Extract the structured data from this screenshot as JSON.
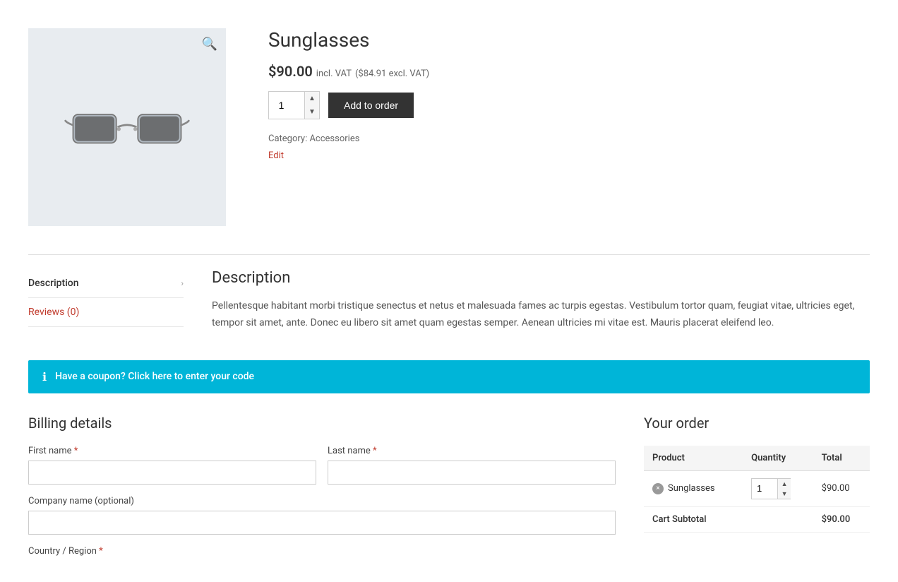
{
  "product": {
    "title": "Sunglasses",
    "price": "$90.00",
    "price_incl": "incl. VAT",
    "price_excl": "($84.91 excl. VAT)",
    "quantity": "1",
    "add_to_order_label": "Add to order",
    "category_label": "Category:",
    "category": "Accessories",
    "edit_label": "Edit"
  },
  "tabs": [
    {
      "label": "Description",
      "active": true,
      "id": "description"
    },
    {
      "label": "Reviews (0)",
      "active": false,
      "id": "reviews",
      "color": "red"
    }
  ],
  "description": {
    "title": "Description",
    "text": "Pellentesque habitant morbi tristique senectus et netus et malesuada fames ac turpis egestas. Vestibulum tortor quam, feugiat vitae, ultricies eget, tempor sit amet, ante. Donec eu libero sit amet quam egestas semper. Aenean ultricies mi vitae est. Mauris placerat eleifend leo."
  },
  "coupon": {
    "text": "Have a coupon? Click here to enter your code"
  },
  "billing": {
    "title": "Billing details",
    "first_name_label": "First name",
    "last_name_label": "Last name",
    "company_name_label": "Company name (optional)",
    "country_label": "Country / Region"
  },
  "order": {
    "title": "Your order",
    "columns": {
      "product": "Product",
      "quantity": "Quantity",
      "total": "Total"
    },
    "items": [
      {
        "name": "Sunglasses",
        "qty": "1",
        "total": "$90.00"
      }
    ],
    "cart_subtotal_label": "Cart Subtotal",
    "cart_subtotal_value": "$90.00"
  },
  "icons": {
    "zoom": "🔍",
    "chevron_right": "›",
    "info": "ℹ",
    "spinner_up": "▲",
    "spinner_down": "▼",
    "remove": "×"
  }
}
